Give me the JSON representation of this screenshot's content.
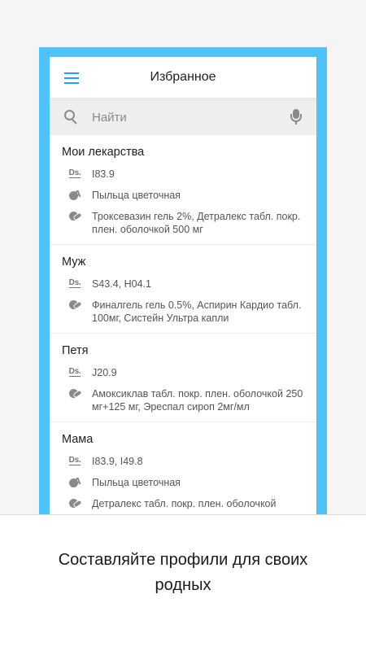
{
  "appbar": {
    "title": "Избранное",
    "menu_icon": "hamburger-menu-icon"
  },
  "search": {
    "placeholder": "Найти",
    "value": "",
    "search_icon": "search-icon",
    "mic_icon": "microphone-icon"
  },
  "profiles": [
    {
      "name": "Мои лекарства",
      "rows": [
        {
          "icon": "diagnosis-icon",
          "text": "I83.9"
        },
        {
          "icon": "allergy-icon",
          "text": "Пыльца цветочная"
        },
        {
          "icon": "medication-icon",
          "text": "Троксевазин гель 2%, Детралекс табл. покр. плен. оболочкой 500 мг"
        }
      ]
    },
    {
      "name": "Муж",
      "rows": [
        {
          "icon": "diagnosis-icon",
          "text": "S43.4, H04.1"
        },
        {
          "icon": "medication-icon",
          "text": "Финалгель гель 0.5%, Аспирин Кардио табл. 100мг, Систейн Ультра капли"
        }
      ]
    },
    {
      "name": "Петя",
      "rows": [
        {
          "icon": "diagnosis-icon",
          "text": "J20.9"
        },
        {
          "icon": "medication-icon",
          "text": "Амоксиклав табл. покр. плен. оболочкой 250 мг+125 мг, Эреспал сироп 2мг/мл"
        }
      ]
    },
    {
      "name": "Мама",
      "rows": [
        {
          "icon": "diagnosis-icon",
          "text": "I83.9, I49.8"
        },
        {
          "icon": "allergy-icon",
          "text": "Пыльца цветочная"
        },
        {
          "icon": "medication-icon",
          "text": "Детралекс табл. покр. плен. оболочкой"
        }
      ]
    }
  ],
  "ds_label": "Ds.",
  "caption": "Составляйте профили для своих родных",
  "colors": {
    "accent": "#29a3e6",
    "frame": "#4fc3f7"
  }
}
